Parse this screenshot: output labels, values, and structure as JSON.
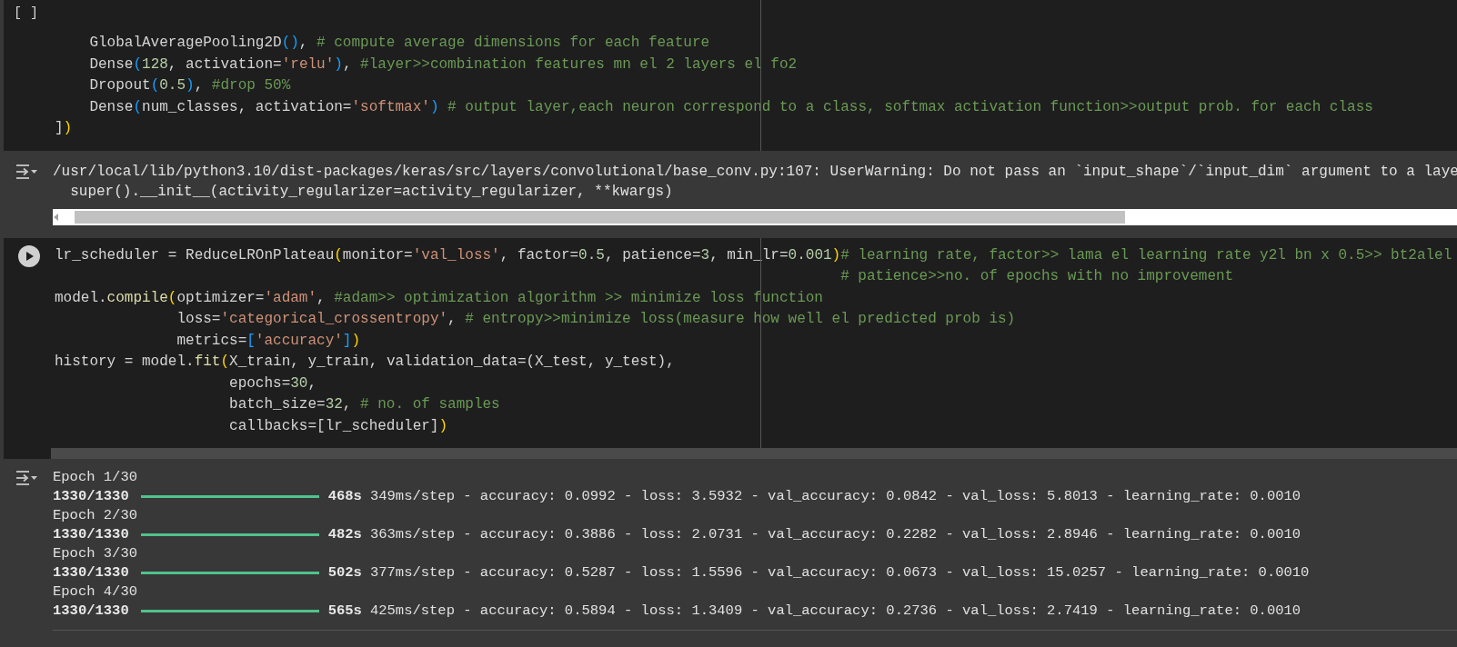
{
  "cells": [
    {
      "kind": "idle",
      "execution_label": "[ ]",
      "code": [
        [
          {
            "kind": "plain",
            "text": "    GlobalAveragePooling2D"
          },
          {
            "kind": "blue",
            "text": "()"
          },
          {
            "kind": "plain",
            "text": ","
          },
          {
            "kind": "comment",
            "text": " # compute average dimensions for each feature"
          }
        ],
        [
          {
            "kind": "plain",
            "text": "    Dense"
          },
          {
            "kind": "blue",
            "text": "("
          },
          {
            "kind": "number",
            "text": "128"
          },
          {
            "kind": "plain",
            "text": ", activation="
          },
          {
            "kind": "string",
            "text": "'relu'"
          },
          {
            "kind": "blue",
            "text": ")"
          },
          {
            "kind": "plain",
            "text": ", "
          },
          {
            "kind": "comment",
            "text": "#layer>>combination features mn el 2 layers el fo2"
          }
        ],
        [
          {
            "kind": "plain",
            "text": "    Dropout"
          },
          {
            "kind": "blue",
            "text": "("
          },
          {
            "kind": "number",
            "text": "0.5"
          },
          {
            "kind": "blue",
            "text": ")"
          },
          {
            "kind": "plain",
            "text": ", "
          },
          {
            "kind": "comment",
            "text": "#drop 50%"
          }
        ],
        [
          {
            "kind": "plain",
            "text": "    Dense"
          },
          {
            "kind": "blue",
            "text": "("
          },
          {
            "kind": "plain",
            "text": "num_classes, activation="
          },
          {
            "kind": "string",
            "text": "'softmax'"
          },
          {
            "kind": "blue",
            "text": ")"
          },
          {
            "kind": "comment",
            "text": " # output layer,each neuron correspond to a class, softmax activation function>>output prob. for each class"
          }
        ],
        [
          {
            "kind": "plain",
            "text": "]"
          },
          {
            "kind": "yellow",
            "text": ")"
          }
        ]
      ],
      "output": {
        "kind": "warning",
        "lines": [
          "/usr/local/lib/python3.10/dist-packages/keras/src/layers/convolutional/base_conv.py:107: UserWarning: Do not pass an `input_shape`/`input_dim` argument to a laye",
          "  super().__init__(activity_regularizer=activity_regularizer, **kwargs)"
        ]
      }
    },
    {
      "kind": "run",
      "code": [
        [
          {
            "kind": "plain",
            "text": "lr_scheduler = ReduceLROnPlateau"
          },
          {
            "kind": "yellow",
            "text": "("
          },
          {
            "kind": "plain",
            "text": "monitor="
          },
          {
            "kind": "string",
            "text": "'val_loss'"
          },
          {
            "kind": "plain",
            "text": ", factor="
          },
          {
            "kind": "number",
            "text": "0.5"
          },
          {
            "kind": "plain",
            "text": ", patience="
          },
          {
            "kind": "number",
            "text": "3"
          },
          {
            "kind": "plain",
            "text": ", min_lr="
          },
          {
            "kind": "number",
            "text": "0.001"
          },
          {
            "kind": "yellow",
            "text": ")"
          },
          {
            "kind": "comment",
            "text": "# learning rate, factor>> lama el learning rate y2l bn x 0.5>> bt2alel"
          }
        ],
        [
          {
            "kind": "comment",
            "text": "                                                                                          # patience>>no. of epochs with no improvement"
          }
        ],
        [
          {
            "kind": "plain",
            "text": "model."
          },
          {
            "kind": "func",
            "text": "compile"
          },
          {
            "kind": "yellow",
            "text": "("
          },
          {
            "kind": "plain",
            "text": "optimizer="
          },
          {
            "kind": "string",
            "text": "'adam'"
          },
          {
            "kind": "plain",
            "text": ", "
          },
          {
            "kind": "comment",
            "text": "#adam>> optimization algorithm >> minimize loss function"
          }
        ],
        [
          {
            "kind": "plain",
            "text": "              loss="
          },
          {
            "kind": "string",
            "text": "'categorical_crossentropy'"
          },
          {
            "kind": "plain",
            "text": ", "
          },
          {
            "kind": "comment",
            "text": "# entropy>>minimize loss(measure how well el predicted prob is)"
          }
        ],
        [
          {
            "kind": "plain",
            "text": "              metrics="
          },
          {
            "kind": "blue",
            "text": "["
          },
          {
            "kind": "string",
            "text": "'accuracy'"
          },
          {
            "kind": "blue",
            "text": "]"
          },
          {
            "kind": "yellow",
            "text": ")"
          }
        ],
        [
          {
            "kind": "plain",
            "text": "history = model."
          },
          {
            "kind": "func",
            "text": "fit"
          },
          {
            "kind": "yellow",
            "text": "("
          },
          {
            "kind": "plain",
            "text": "X_train, y_train, validation_data=(X_test, y_test),"
          }
        ],
        [
          {
            "kind": "plain",
            "text": "                    epochs="
          },
          {
            "kind": "number",
            "text": "30"
          },
          {
            "kind": "plain",
            "text": ","
          }
        ],
        [
          {
            "kind": "plain",
            "text": "                    batch_size="
          },
          {
            "kind": "number",
            "text": "32"
          },
          {
            "kind": "plain",
            "text": ", "
          },
          {
            "kind": "comment",
            "text": "# no. of samples"
          }
        ],
        [
          {
            "kind": "plain",
            "text": "                    callbacks=[lr_scheduler]"
          },
          {
            "kind": "yellow",
            "text": ")"
          }
        ]
      ],
      "output": {
        "kind": "progress",
        "epochs": [
          {
            "label": "Epoch 1/30",
            "steps": "1330/1330",
            "level": 1,
            "time": "468s",
            "metrics": "349ms/step - accuracy: 0.0992 - loss: 3.5932 - val_accuracy: 0.0842 - val_loss: 5.8013 - learning_rate: 0.0010"
          },
          {
            "label": "Epoch 2/30",
            "steps": "1330/1330",
            "level": 1,
            "time": "482s",
            "metrics": "363ms/step - accuracy: 0.3886 - loss: 2.0731 - val_accuracy: 0.2282 - val_loss: 2.8946 - learning_rate: 0.0010"
          },
          {
            "label": "Epoch 3/30",
            "steps": "1330/1330",
            "level": 1,
            "time": "502s",
            "metrics": "377ms/step - accuracy: 0.5287 - loss: 1.5596 - val_accuracy: 0.0673 - val_loss: 15.0257 - learning_rate: 0.0010"
          },
          {
            "label": "Epoch 4/30",
            "steps": "1330/1330",
            "level": 1,
            "time": "565s",
            "metrics": "425ms/step - accuracy: 0.5894 - loss: 1.3409 - val_accuracy: 0.2736 - val_loss: 2.7419 - learning_rate: 0.0010"
          }
        ]
      }
    }
  ]
}
